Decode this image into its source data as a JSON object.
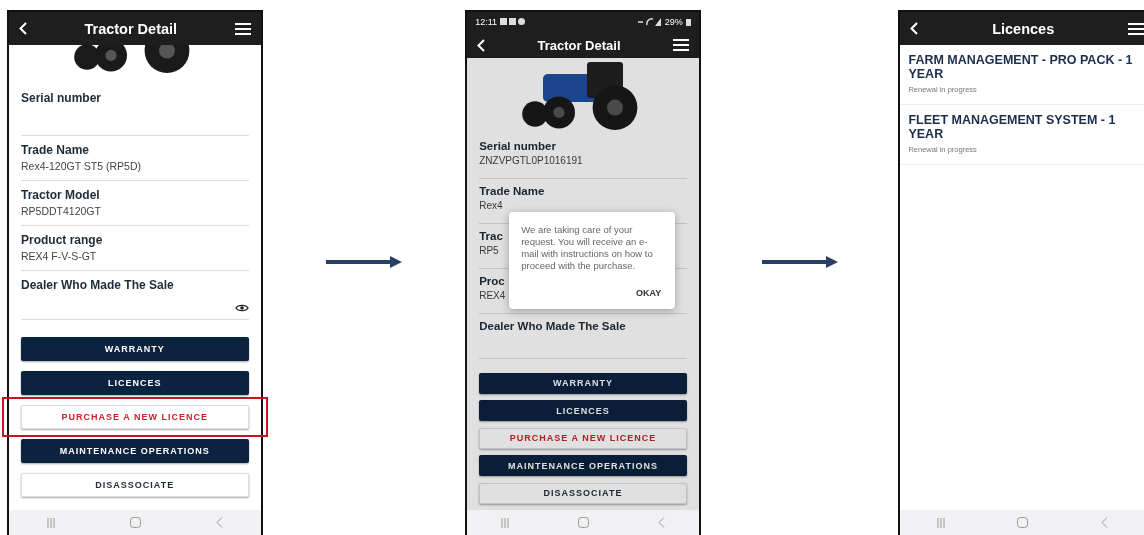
{
  "detail_screen": {
    "title": "Tractor Detail",
    "fields": [
      {
        "label": "Serial number",
        "kind": "text"
      },
      {
        "label": "Trade Name",
        "value": "Rex4-120GT ST5 (RP5D)",
        "kind": "text"
      },
      {
        "label": "Tractor Model",
        "value": "RP5DDT4120GT",
        "kind": "text"
      },
      {
        "label": "Product range",
        "value": "REX4 F-V-S-GT",
        "kind": "text"
      },
      {
        "label": "Dealer Who Made The Sale",
        "kind": "hidden"
      }
    ],
    "buttons": [
      {
        "label": "WARRANTY",
        "kind": "primary",
        "highlighted": false
      },
      {
        "label": "LICENCES",
        "kind": "primary",
        "highlighted": false
      },
      {
        "label": "PURCHASE A NEW LICENCE",
        "kind": "accent",
        "highlighted": true
      },
      {
        "label": "MAINTENANCE OPERATIONS",
        "kind": "primary",
        "highlighted": false
      },
      {
        "label": "DISASSOCIATE",
        "kind": "outline",
        "highlighted": false
      }
    ]
  },
  "dialog_screen": {
    "status_bar": {
      "time": "12:11",
      "battery": "29%"
    },
    "title": "Tractor Detail",
    "fields": [
      {
        "label": "Serial number",
        "value": "ZNZVPGTL0P1016191"
      },
      {
        "label": "Trade Name",
        "value": "Rex4"
      },
      {
        "label": "Trac",
        "value": "RP5"
      },
      {
        "label": "Proc",
        "value": "REX4"
      },
      {
        "label": "Dealer Who Made The Sale"
      }
    ],
    "dialog": {
      "message": "We are taking care of your request. You will receive an e-mail with instructions on how to proceed with the purchase.",
      "button": "OKAY"
    },
    "buttons": [
      {
        "label": "WARRANTY",
        "kind": "primary",
        "highlighted": false
      },
      {
        "label": "LICENCES",
        "kind": "primary",
        "highlighted": false
      },
      {
        "label": "PURCHASE A NEW LICENCE",
        "kind": "accent",
        "highlighted": false
      },
      {
        "label": "MAINTENANCE OPERATIONS",
        "kind": "primary",
        "highlighted": false
      },
      {
        "label": "DISASSOCIATE",
        "kind": "outline",
        "highlighted": false
      }
    ]
  },
  "licences_screen": {
    "title": "Licences",
    "items": [
      {
        "name": "FARM MANAGEMENT - PRO PACK - 1 YEAR",
        "status": "Renewal in progress"
      },
      {
        "name": "FLEET MANAGEMENT SYSTEM - 1 YEAR",
        "status": "Renewal in progress"
      }
    ]
  }
}
